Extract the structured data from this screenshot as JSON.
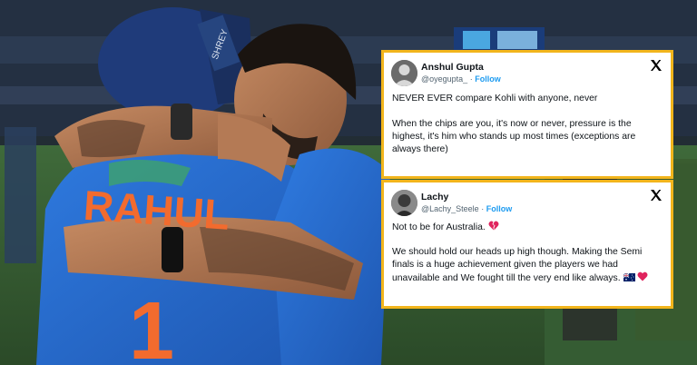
{
  "tweets": [
    {
      "name": "Anshul Gupta",
      "handle": "@oyegupta_",
      "follow_label": "Follow",
      "paragraph1": "NEVER EVER compare Kohli with anyone, never",
      "paragraph2": "When the chips are you, it's now or never, pressure is the highest, it's him who stands up most times (exceptions are always there)"
    },
    {
      "name": "Lachy",
      "handle": "@Lachy_Steele",
      "follow_label": "Follow",
      "paragraph1": "Not to be for Australia.",
      "paragraph2": "We should hold our heads up high though. Making the Semi finals is a huge achievement given the players we had unavailable and We fought till the very end like always."
    }
  ],
  "photo": {
    "jersey_text": "RAHUL",
    "jersey_number": "1",
    "helmet_text": "SHREY"
  },
  "colors": {
    "card_border": "#f2b51c",
    "follow": "#1d9bf0",
    "jersey": "#2a6fd6",
    "jersey_text": "#f26b2e"
  }
}
